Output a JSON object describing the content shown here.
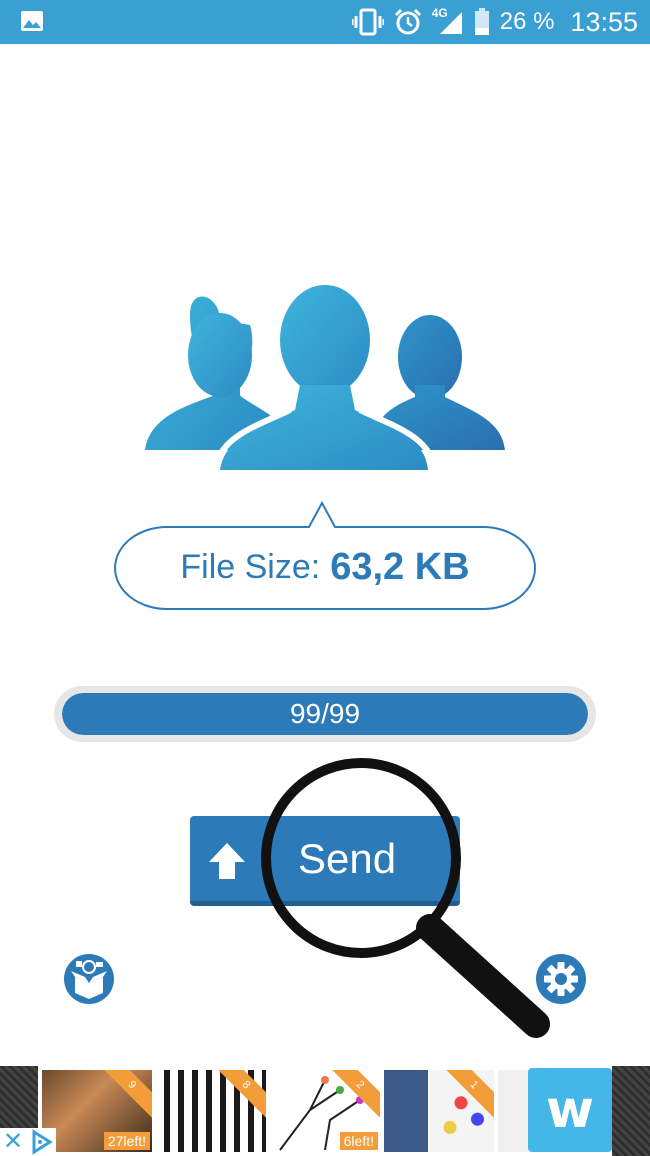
{
  "status_bar": {
    "battery_text": "26 %",
    "time": "13:55",
    "network": "4G",
    "color": "#3a9fd2",
    "icons": [
      "image-icon",
      "vibrate-icon",
      "alarm-icon",
      "signal-icon",
      "battery-icon"
    ]
  },
  "file_size": {
    "label": "File Size:",
    "value": "63,2 KB"
  },
  "progress": {
    "text": "99/99",
    "fraction": 1.0
  },
  "send_button": {
    "label": "Send"
  },
  "colors": {
    "accent": "#2c7ab8",
    "illustration_light": "#3fb0d8",
    "illustration_dark": "#2c7ab8"
  },
  "ad": {
    "tiles": [
      {
        "tag": "27left!",
        "ribbon": "9"
      },
      {
        "tag": "",
        "ribbon": "8"
      },
      {
        "tag": "6left!",
        "ribbon": "2"
      },
      {
        "tag": "",
        "ribbon": "1"
      }
    ],
    "brand_glyph": "w",
    "close_glyph": "✕"
  }
}
